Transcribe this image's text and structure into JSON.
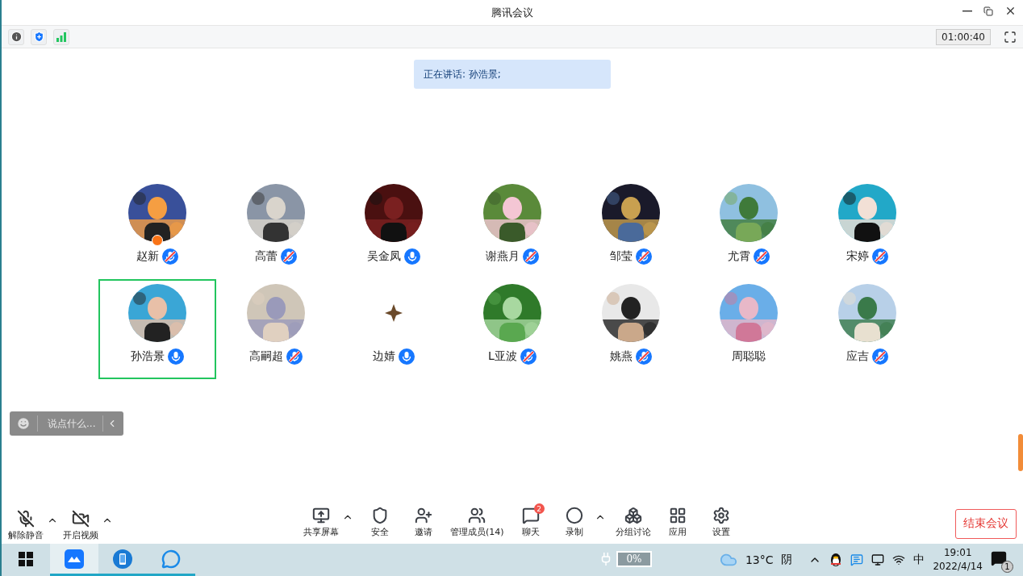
{
  "window": {
    "title": "腾讯会议"
  },
  "top_bar": {
    "timer": "01:00:40"
  },
  "speaking_banner": "正在讲话: 孙浩景;",
  "participants": [
    {
      "name": "赵新",
      "has_mic": true,
      "muted": true,
      "host": true,
      "selected": false,
      "kind": "picture"
    },
    {
      "name": "高蕾",
      "has_mic": true,
      "muted": true,
      "host": false,
      "selected": false,
      "kind": "picture"
    },
    {
      "name": "吴金凤",
      "has_mic": true,
      "muted": false,
      "host": false,
      "selected": false,
      "kind": "picture"
    },
    {
      "name": "谢燕月",
      "has_mic": true,
      "muted": true,
      "host": false,
      "selected": false,
      "kind": "picture"
    },
    {
      "name": "邹莹",
      "has_mic": true,
      "muted": true,
      "host": false,
      "selected": false,
      "kind": "picture"
    },
    {
      "name": "尤霄",
      "has_mic": true,
      "muted": true,
      "host": false,
      "selected": false,
      "kind": "picture"
    },
    {
      "name": "宋婷",
      "has_mic": true,
      "muted": true,
      "host": false,
      "selected": false,
      "kind": "picture"
    },
    {
      "name": "孙浩景",
      "has_mic": true,
      "muted": false,
      "host": false,
      "selected": true,
      "kind": "picture"
    },
    {
      "name": "高嗣超",
      "has_mic": true,
      "muted": true,
      "host": false,
      "selected": false,
      "kind": "picture"
    },
    {
      "name": "边婧",
      "has_mic": true,
      "muted": false,
      "host": false,
      "selected": false,
      "kind": "icon"
    },
    {
      "name": "L亚波",
      "has_mic": true,
      "muted": true,
      "host": false,
      "selected": false,
      "kind": "picture"
    },
    {
      "name": "姚燕",
      "has_mic": true,
      "muted": true,
      "host": false,
      "selected": false,
      "kind": "picture"
    },
    {
      "name": "周聪聪",
      "has_mic": false,
      "host": false,
      "selected": false,
      "kind": "picture"
    },
    {
      "name": "应吉",
      "has_mic": true,
      "muted": true,
      "host": false,
      "selected": false,
      "kind": "picture"
    }
  ],
  "chat_input": {
    "placeholder": "说点什么..."
  },
  "toolbar": {
    "left": [
      {
        "label": "解除静音",
        "kind": "mic-off",
        "caret": true
      },
      {
        "label": "开启视频",
        "kind": "video-off",
        "caret": true
      }
    ],
    "center": [
      {
        "label": "共享屏幕",
        "kind": "share",
        "caret": true
      },
      {
        "label": "安全",
        "kind": "shield",
        "caret": false
      },
      {
        "label": "邀请",
        "kind": "invite",
        "caret": false
      },
      {
        "label": "管理成员(14)",
        "kind": "members",
        "caret": false
      },
      {
        "label": "聊天",
        "kind": "chat",
        "caret": false,
        "badge": "2"
      },
      {
        "label": "录制",
        "kind": "record",
        "caret": true
      },
      {
        "label": "分组讨论",
        "kind": "breakout",
        "caret": false
      },
      {
        "label": "应用",
        "kind": "apps",
        "caret": false
      },
      {
        "label": "设置",
        "kind": "settings",
        "caret": false
      }
    ],
    "end_button": "结束会议"
  },
  "taskbar": {
    "battery": "0%",
    "temperature": "13°C",
    "weather": "阴",
    "ime": "中",
    "time": "19:01",
    "date": "2022/4/14",
    "notifications": "1"
  }
}
